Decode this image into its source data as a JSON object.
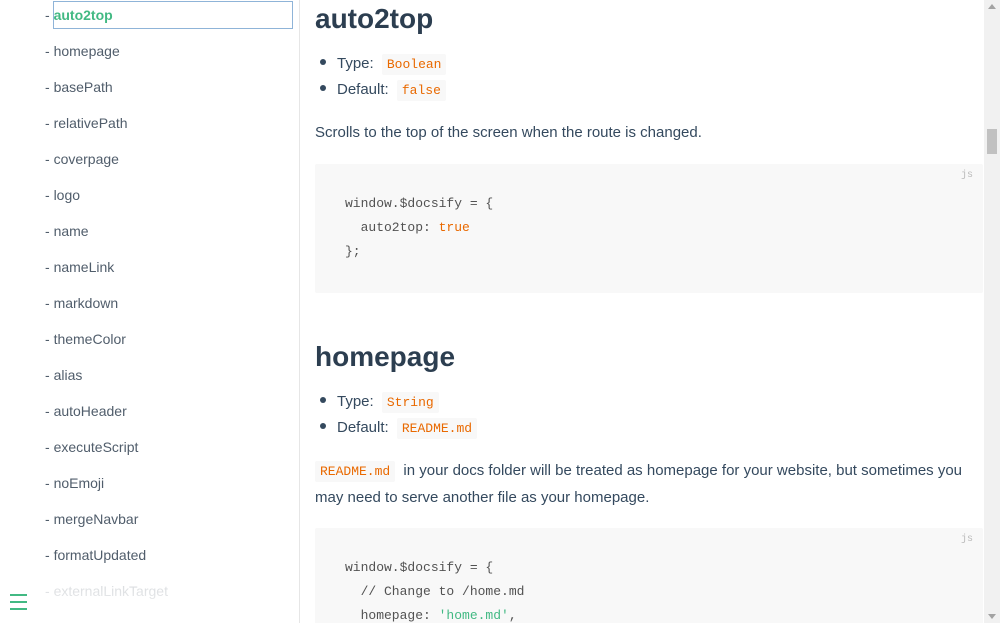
{
  "sidebar": {
    "items": [
      {
        "label": "auto2top",
        "active": true
      },
      {
        "label": "homepage"
      },
      {
        "label": "basePath"
      },
      {
        "label": "relativePath"
      },
      {
        "label": "coverpage"
      },
      {
        "label": "logo"
      },
      {
        "label": "name"
      },
      {
        "label": "nameLink"
      },
      {
        "label": "markdown"
      },
      {
        "label": "themeColor"
      },
      {
        "label": "alias"
      },
      {
        "label": "autoHeader"
      },
      {
        "label": "executeScript"
      },
      {
        "label": "noEmoji"
      },
      {
        "label": "mergeNavbar"
      },
      {
        "label": "formatUpdated"
      },
      {
        "label": "externalLinkTarget",
        "faded": true
      }
    ],
    "dash": "-",
    "toggle_icon": "menu-icon",
    "accent_color": "#42b983"
  },
  "sections": {
    "auto2top": {
      "title": "auto2top",
      "type_label": "Type:",
      "type_value": "Boolean",
      "default_label": "Default:",
      "default_value": "false",
      "description": "Scrolls to the top of the screen when the route is changed.",
      "code_lang": "js",
      "code": {
        "line1": "window.$docsify = {",
        "line2_key": "  auto2top: ",
        "line2_val": "true",
        "line3": "};"
      }
    },
    "homepage": {
      "title": "homepage",
      "type_label": "Type:",
      "type_value": "String",
      "default_label": "Default:",
      "default_value": "README.md",
      "description_code": "README.md",
      "description": "in your docs folder will be treated as homepage for your website, but sometimes you may need to serve another file as your homepage.",
      "code_lang": "js",
      "code": {
        "line1": "window.$docsify = {",
        "line2": "  // Change to /home.md",
        "line3_key": "  homepage: ",
        "line3_val": "'home.md'",
        "line3_end": ","
      }
    }
  }
}
